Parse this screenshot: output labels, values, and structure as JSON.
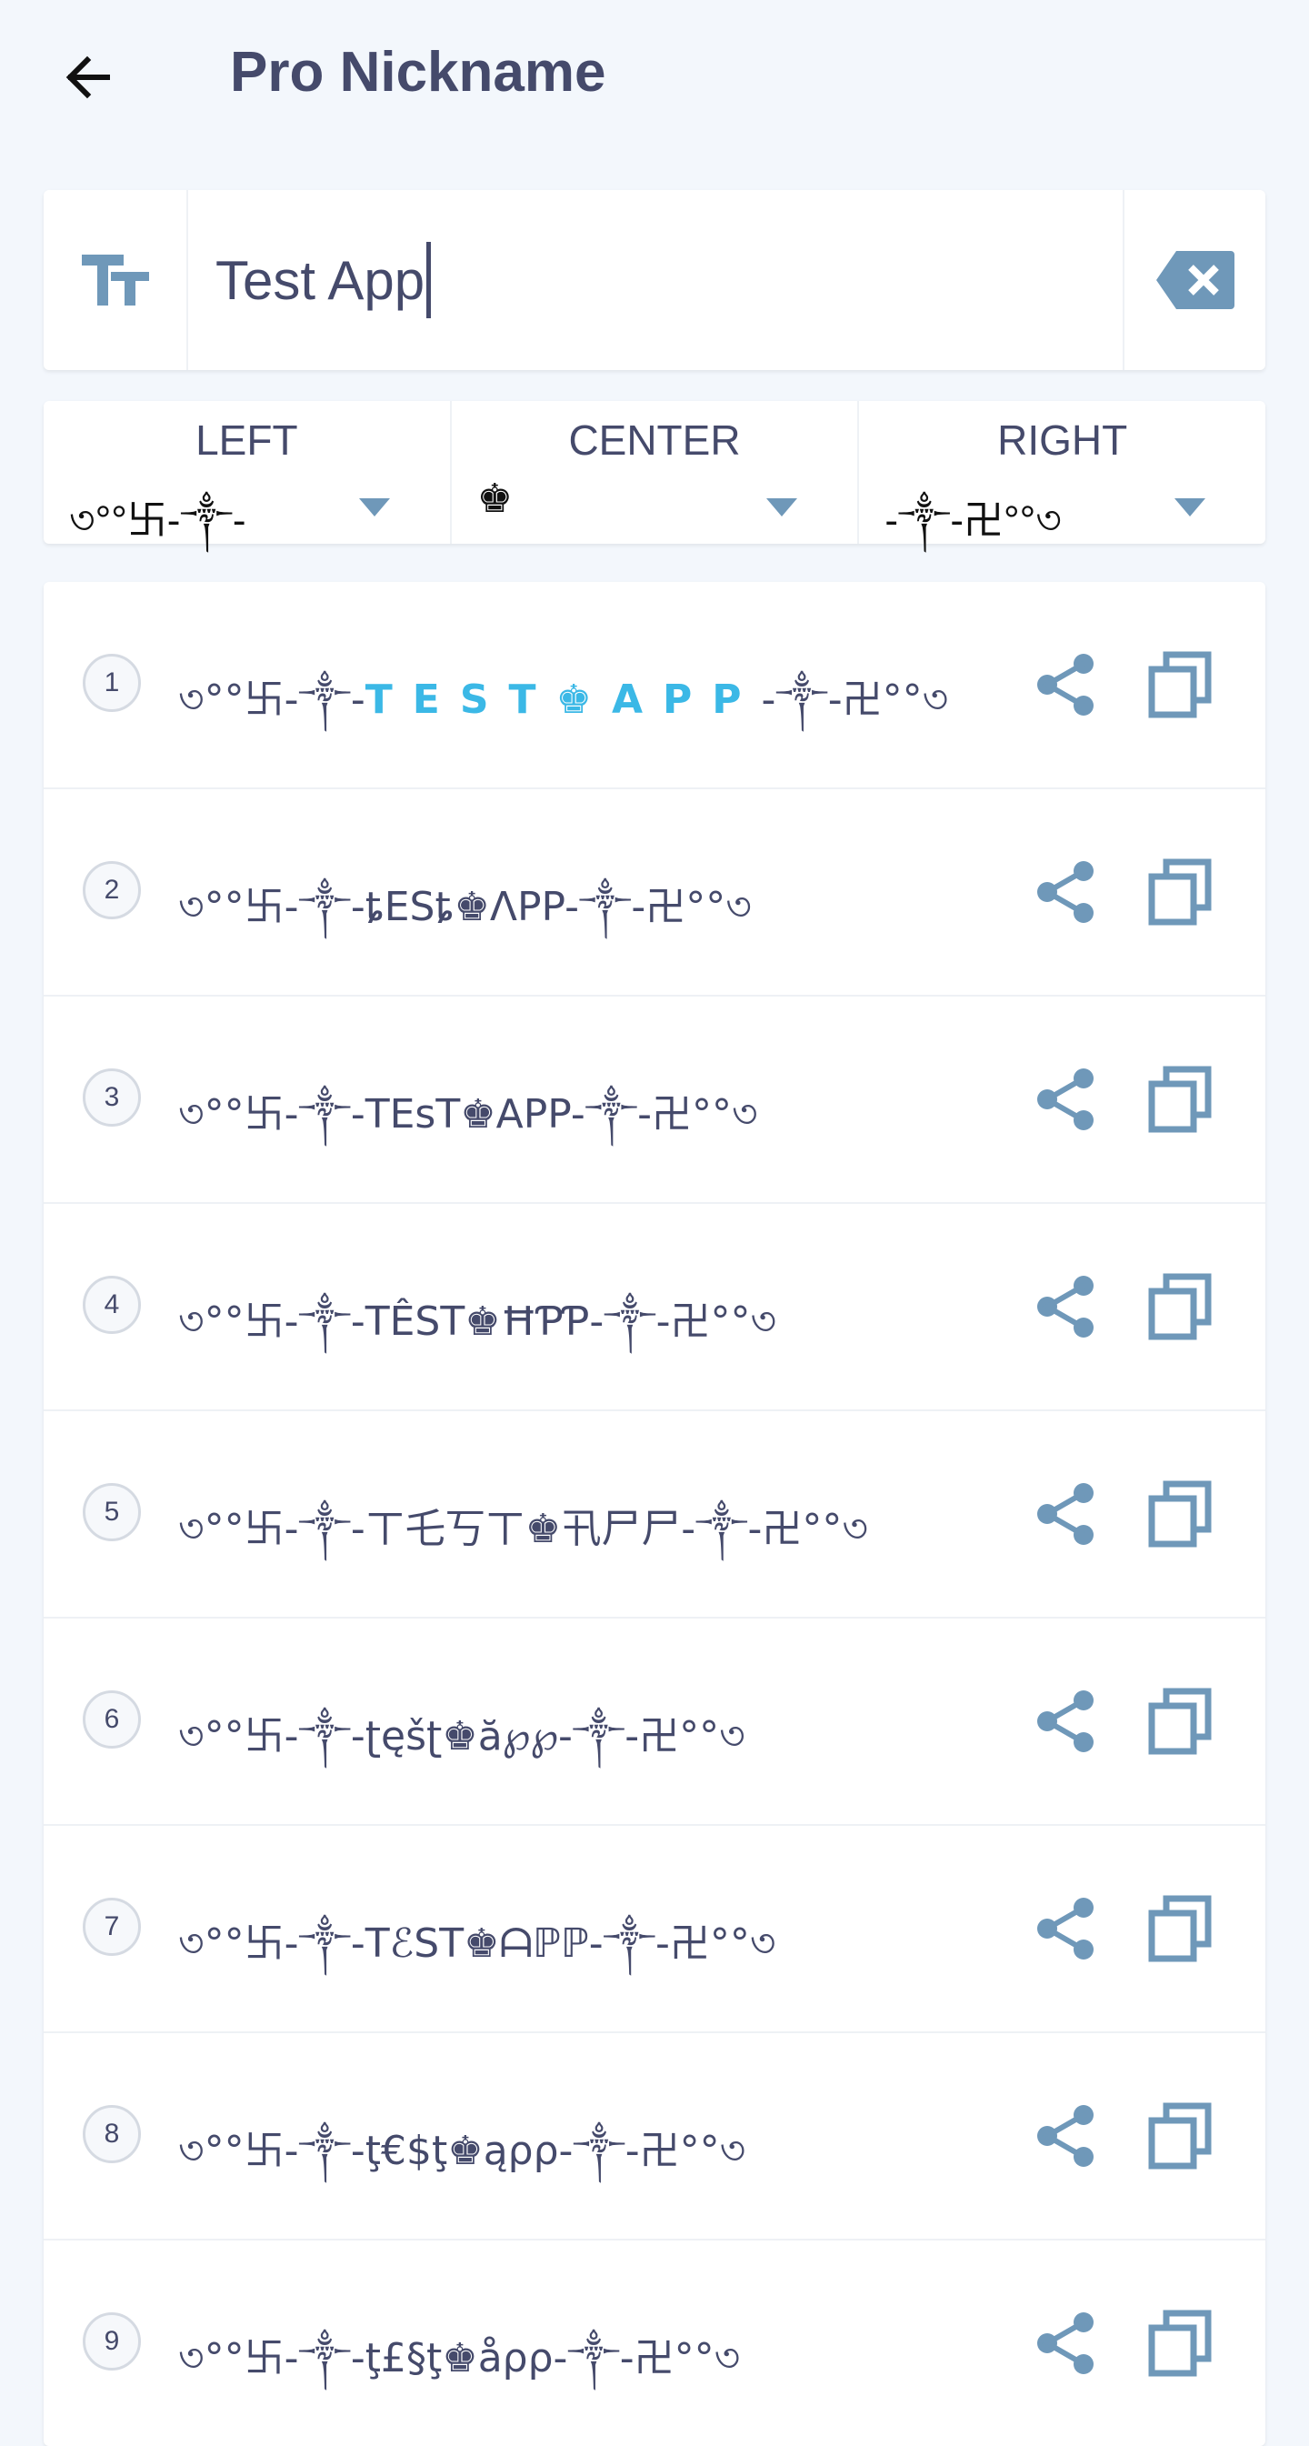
{
  "header": {
    "title": "Pro Nickname",
    "back_icon": "arrow-left-icon"
  },
  "input": {
    "value": "Test App",
    "left_icon": "text-size-icon",
    "clear_icon": "backspace-clear-icon"
  },
  "decorations": [
    {
      "label": "LEFT",
      "value": "৩°°卐-༒-"
    },
    {
      "label": "CENTER",
      "value": "♚"
    },
    {
      "label": "RIGHT",
      "value": "-༒-卍°°৩"
    }
  ],
  "colors": {
    "accent": "#3bb8e6",
    "icon": "#6f98b9",
    "text": "#454a6b",
    "background": "#f3f7fc"
  },
  "results": [
    {
      "index": "1",
      "prefix": "৩°°卐-༒-",
      "core": "TEST♚APP",
      "suffix": "-༒-卍°°৩"
    },
    {
      "index": "2",
      "prefix": "৩°°卐-༒-",
      "core": "ȶΕSȶ♚ΛPP",
      "suffix": "-༒-卍°°৩"
    },
    {
      "index": "3",
      "prefix": "৩°°卐-༒-",
      "core": "TEsT♚APP",
      "suffix": "-༒-卍°°৩"
    },
    {
      "index": "4",
      "prefix": "৩°°卐-༒-",
      "core": "TÊST♚ĦƤƤ",
      "suffix": "-༒-卍°°৩"
    },
    {
      "index": "5",
      "prefix": "৩°°卐-༒-",
      "core": "ㄒ乇丂ㄒ♚卂尸尸",
      "suffix": "-༒-卍°°৩"
    },
    {
      "index": "6",
      "prefix": "৩°°卐-༒-",
      "core": "ʈęšʈ♚ă℘℘",
      "suffix": "-༒-卍°°৩"
    },
    {
      "index": "7",
      "prefix": "৩°°卐-༒-",
      "core": "TℰST♚ᗩℙℙ",
      "suffix": "-༒-卍°°৩"
    },
    {
      "index": "8",
      "prefix": "৩°°卐-༒-",
      "core": "ţ€$ţ♚ąρρ",
      "suffix": "-༒-卍°°৩"
    },
    {
      "index": "9",
      "prefix": "৩°°卐-༒-",
      "core": "ţ£§ţ♚åρρ",
      "suffix": "-༒-卍°°৩"
    }
  ],
  "row_icons": {
    "share": "share-icon",
    "copy": "copy-icon"
  }
}
